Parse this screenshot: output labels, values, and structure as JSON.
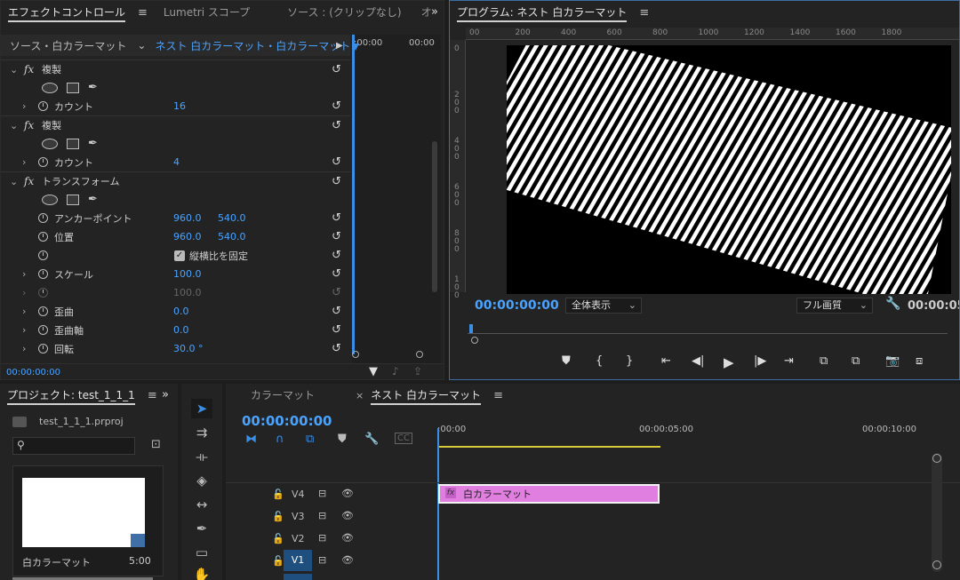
{
  "effect_controls": {
    "tabs": [
      "エフェクトコントロール",
      "Lumetri スコープ",
      "ソース : (クリップなし)",
      "オ"
    ],
    "source_label": "ソース・白カラーマット",
    "sequence_label": "ネスト 白カラーマット・白カラーマット",
    "tl_time_start": ":00:00",
    "tl_time_end": "00:00",
    "footer_time": "00:00:00:00",
    "effects": [
      {
        "name": "複製",
        "count_label": "カウント",
        "count_value": "16"
      },
      {
        "name": "複製",
        "count_label": "カウント",
        "count_value": "4"
      }
    ],
    "transform": {
      "name": "トランスフォーム",
      "anchor_label": "アンカーポイント",
      "anchor_x": "960.0",
      "anchor_y": "540.0",
      "position_label": "位置",
      "position_x": "960.0",
      "position_y": "540.0",
      "aspect_label": "縦横比を固定",
      "scale_label": "スケール",
      "scale_value": "100.0",
      "scale_w_value": "100.0",
      "skew_label": "歪曲",
      "skew_value": "0.0",
      "skew_axis_label": "歪曲軸",
      "skew_axis_value": "0.0",
      "rotation_label": "回転",
      "rotation_value": "30.0 °"
    }
  },
  "program": {
    "title": "プログラム: ネスト 白カラーマット",
    "ruler_top": [
      "00",
      "200",
      "400",
      "600",
      "800",
      "1000",
      "1200",
      "1400",
      "1600",
      "1800"
    ],
    "ruler_left": [
      "0",
      "200",
      "400",
      "600",
      "800",
      "100"
    ],
    "timecode": "00:00:00:00",
    "zoom": "全体表示",
    "quality": "フル画質",
    "duration": "00:00:05:"
  },
  "project": {
    "title": "プロジェクト: test_1_1_1",
    "file": "test_1_1_1.prproj",
    "clip_name": "白カラーマット",
    "clip_duration": "5:00"
  },
  "timeline": {
    "tabs": [
      "カラーマット",
      "ネスト 白カラーマット"
    ],
    "timecode": "00:00:00:00",
    "ruler": [
      ":00:00",
      "00:00:05:00",
      "00:00:10:00"
    ],
    "clip_label": "白カラーマット",
    "tracks": [
      "V4",
      "V3",
      "V2",
      "V1"
    ]
  }
}
